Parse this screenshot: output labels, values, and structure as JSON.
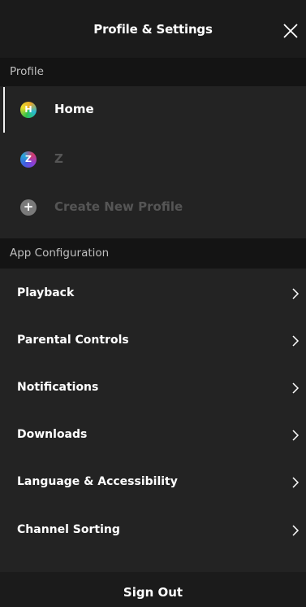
{
  "header": {
    "title": "Profile & Settings",
    "close_icon": "close-icon"
  },
  "profile_section": {
    "heading": "Profile",
    "items": [
      {
        "avatar_letter": "H",
        "label": "Home",
        "active": true
      },
      {
        "avatar_letter": "Z",
        "label": "Z",
        "active": false
      },
      {
        "avatar_letter": "+",
        "label": "Create New Profile",
        "active": false
      }
    ]
  },
  "app_section": {
    "heading": "App Configuration",
    "items": [
      {
        "label": "Playback"
      },
      {
        "label": "Parental Controls"
      },
      {
        "label": "Notifications"
      },
      {
        "label": "Downloads"
      },
      {
        "label": "Language & Accessibility"
      },
      {
        "label": "Channel Sorting"
      }
    ]
  },
  "footer": {
    "sign_out_label": "Sign Out"
  },
  "colors": {
    "background": "#232323",
    "header_bg": "#1b1b1b",
    "section_bg": "#141414",
    "text": "#ffffff",
    "dim_text": "#555555"
  }
}
